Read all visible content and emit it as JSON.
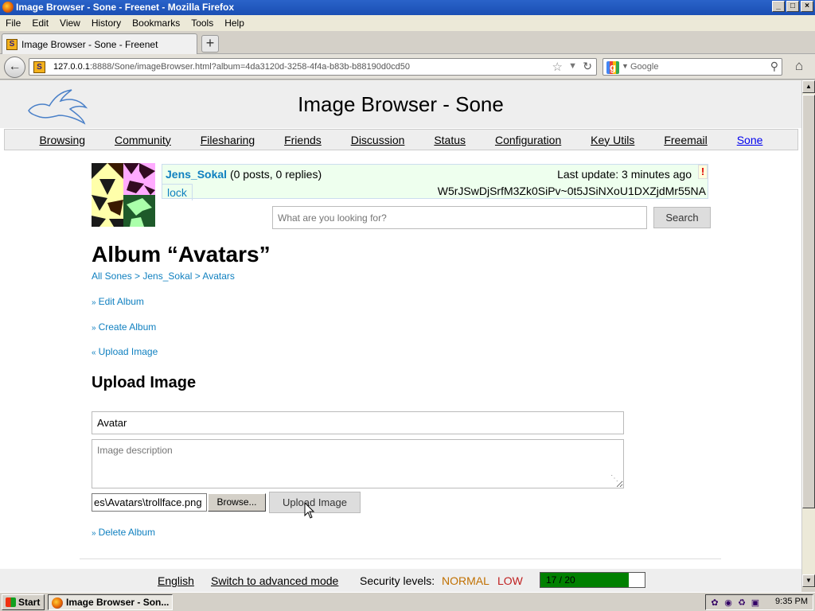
{
  "window": {
    "title": "Image Browser - Sone - Freenet - Mozilla Firefox",
    "controls": [
      "_",
      "□",
      "×"
    ]
  },
  "menu": [
    "File",
    "Edit",
    "View",
    "History",
    "Bookmarks",
    "Tools",
    "Help"
  ],
  "tab": {
    "label": "Image Browser - Sone - Freenet",
    "new_tab": "+"
  },
  "nav": {
    "url_host": "127.0.0.1",
    "url_rest": ":8888/Sone/imageBrowser.html?album=4da3120d-3258-4f4a-b83b-b88190d0cd50",
    "search_placeholder": "Google"
  },
  "page": {
    "title": "Image Browser - Sone",
    "topnav": [
      "Browsing",
      "Community",
      "Filesharing",
      "Friends",
      "Discussion",
      "Status",
      "Configuration",
      "Key Utils",
      "Freemail",
      "Sone"
    ],
    "sone": {
      "name": "Jens_Sokal",
      "stats": " (0 posts, 0 replies)",
      "last_update": "Last update: 3 minutes ago",
      "lock": "lock",
      "id": "W5rJSwDjSrfM3Zk0SiPv~0t5JSiNXoU1DXZjdMr55NA",
      "alert": "!"
    },
    "search": {
      "placeholder": "What are you looking for?",
      "button": "Search"
    },
    "album_title": "Album “Avatars”",
    "breadcrumb": "All Sones > Jens_Sokal > Avatars",
    "actions": {
      "edit": "Edit Album",
      "create": "Create Album",
      "upload": "Upload Image",
      "delete": "Delete Album"
    },
    "upload": {
      "heading": "Upload Image",
      "title_value": "Avatar",
      "description_placeholder": "Image description",
      "file_path": "es\\Avatars\\trollface.png",
      "browse": "Browse...",
      "submit": "Upload Image"
    },
    "footer": {
      "language": "English",
      "mode": "Switch to advanced mode",
      "security_label": "Security levels:",
      "security_normal": "NORMAL",
      "security_low": "LOW",
      "peers": "17 / 20",
      "peers_fraction": 0.85
    }
  },
  "taskbar": {
    "start": "Start",
    "task": "Image Browser - Son...",
    "clock": "9:35 PM"
  }
}
